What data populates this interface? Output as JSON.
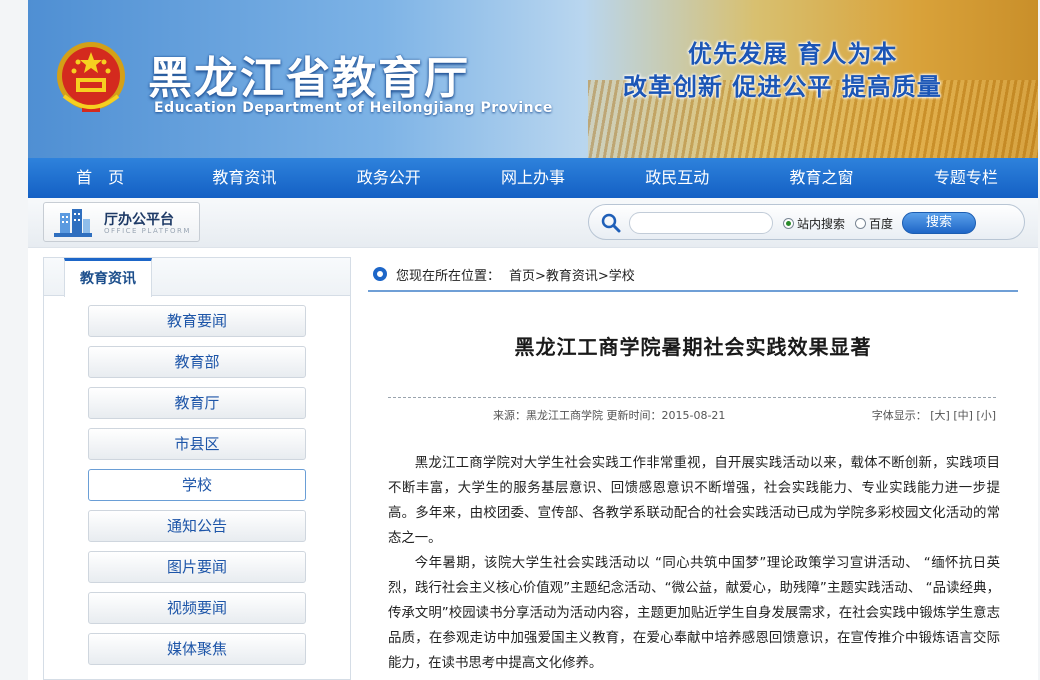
{
  "header": {
    "title": "黑龙江省教育厅",
    "subtitle": "Education Department of Heilongjiang Province",
    "slogan_line1": "优先发展  育人为本",
    "slogan_line2": "改革创新  促进公平  提高质量",
    "emblem_icon": "national-emblem-icon"
  },
  "nav": {
    "items": [
      "首　页",
      "教育资讯",
      "政务公开",
      "网上办事",
      "政民互动",
      "教育之窗",
      "专题专栏"
    ]
  },
  "toolbar": {
    "office_label": "厅办公平台",
    "office_sub": "OFFICE PLATFORM",
    "search_placeholder": "",
    "radio_site": "站内搜索",
    "radio_baidu": "百度",
    "search_button": "搜索"
  },
  "sidebar": {
    "tab": "教育资讯",
    "items": [
      "教育要闻",
      "教育部",
      "教育厅",
      "市县区",
      "学校",
      "通知公告",
      "图片要闻",
      "视频要闻",
      "媒体聚焦"
    ],
    "active_index": 4
  },
  "breadcrumb": {
    "label": "您现在所在位置：",
    "path": "首页>教育资讯>学校"
  },
  "article": {
    "title": "黑龙江工商学院暑期社会实践效果显著",
    "meta": "来源：黑龙江工商学院  更新时间：2015-08-21",
    "font_label": "字体显示：",
    "font_large": "[大]",
    "font_medium": "[中]",
    "font_small": "[小]",
    "paragraphs": [
      "黑龙江工商学院对大学生社会实践工作非常重视，自开展实践活动以来，载体不断创新，实践项目不断丰富，大学生的服务基层意识、回馈感恩意识不断增强，社会实践能力、专业实践能力进一步提高。多年来，由校团委、宣传部、各教学系联动配合的社会实践活动已成为学院多彩校园文化活动的常态之一。",
      "今年暑期，该院大学生社会实践活动以 “同心共筑中国梦”理论政策学习宣讲活动、 “缅怀抗日英烈，践行社会主义核心价值观”主题纪念活动、“微公益，献爱心，助残障”主题实践活动、 “品读经典，传承文明”校园读书分享活动为活动内容，主题更加贴近学生自身发展需求，在社会实践中锻炼学生意志品质，在参观走访中加强爱国主义教育，在爱心奉献中培养感恩回馈意识，在宣传推介中锻炼语言交际能力，在读书思考中提高文化修养。"
    ]
  },
  "colors": {
    "nav_blue": "#1d6ad0",
    "link_blue": "#1d55a8",
    "accent_border": "#6f9fd6"
  }
}
